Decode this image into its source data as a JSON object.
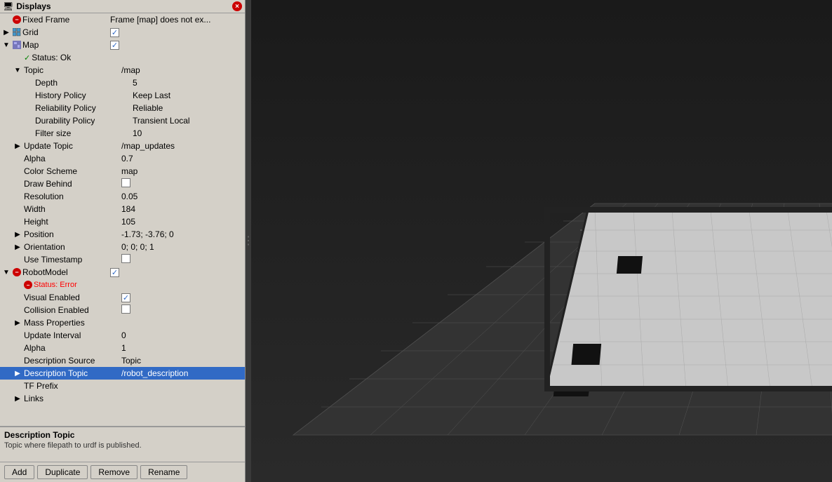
{
  "window": {
    "title": "Displays",
    "close_label": "×"
  },
  "tree": {
    "rows": [
      {
        "id": "fixed-frame",
        "indent": 0,
        "expander": null,
        "icon": "error",
        "label": "Fixed Frame",
        "value": "Frame [map] does not ex...",
        "selected": false,
        "type": "property"
      },
      {
        "id": "grid",
        "indent": 0,
        "expander": "collapsed",
        "icon": "grid",
        "label": "Grid",
        "value": "checkbox-checked",
        "selected": false,
        "type": "item"
      },
      {
        "id": "map",
        "indent": 0,
        "expander": "collapsed",
        "icon": "map",
        "label": "Map",
        "value": "checkbox-checked",
        "selected": false,
        "type": "item"
      },
      {
        "id": "map-status",
        "indent": 1,
        "expander": null,
        "icon": "ok",
        "label": "Status: Ok",
        "value": "",
        "selected": false,
        "type": "status"
      },
      {
        "id": "topic-section",
        "indent": 1,
        "expander": "expanded",
        "icon": null,
        "label": "Topic",
        "value": "/map",
        "selected": false,
        "type": "property"
      },
      {
        "id": "depth",
        "indent": 2,
        "expander": null,
        "icon": null,
        "label": "Depth",
        "value": "5",
        "selected": false,
        "type": "property"
      },
      {
        "id": "history-policy",
        "indent": 2,
        "expander": null,
        "icon": null,
        "label": "History Policy",
        "value": "Keep Last",
        "selected": false,
        "type": "property"
      },
      {
        "id": "reliability-policy",
        "indent": 2,
        "expander": null,
        "icon": null,
        "label": "Reliability Policy",
        "value": "Reliable",
        "selected": false,
        "type": "property"
      },
      {
        "id": "durability-policy",
        "indent": 2,
        "expander": null,
        "icon": null,
        "label": "Durability Policy",
        "value": "Transient Local",
        "selected": false,
        "type": "property"
      },
      {
        "id": "filter-size",
        "indent": 2,
        "expander": null,
        "icon": null,
        "label": "Filter size",
        "value": "10",
        "selected": false,
        "type": "property"
      },
      {
        "id": "update-topic",
        "indent": 1,
        "expander": "collapsed",
        "icon": null,
        "label": "Update Topic",
        "value": "/map_updates",
        "selected": false,
        "type": "property"
      },
      {
        "id": "alpha",
        "indent": 1,
        "expander": null,
        "icon": null,
        "label": "Alpha",
        "value": "0.7",
        "selected": false,
        "type": "property"
      },
      {
        "id": "color-scheme",
        "indent": 1,
        "expander": null,
        "icon": null,
        "label": "Color Scheme",
        "value": "map",
        "selected": false,
        "type": "property"
      },
      {
        "id": "draw-behind",
        "indent": 1,
        "expander": null,
        "icon": null,
        "label": "Draw Behind",
        "value": "checkbox-empty",
        "selected": false,
        "type": "property"
      },
      {
        "id": "resolution",
        "indent": 1,
        "expander": null,
        "icon": null,
        "label": "Resolution",
        "value": "0.05",
        "selected": false,
        "type": "property"
      },
      {
        "id": "width",
        "indent": 1,
        "expander": null,
        "icon": null,
        "label": "Width",
        "value": "184",
        "selected": false,
        "type": "property"
      },
      {
        "id": "height",
        "indent": 1,
        "expander": null,
        "icon": null,
        "label": "Height",
        "value": "105",
        "selected": false,
        "type": "property"
      },
      {
        "id": "position",
        "indent": 1,
        "expander": "collapsed",
        "icon": null,
        "label": "Position",
        "value": "-1.73; -3.76; 0",
        "selected": false,
        "type": "property"
      },
      {
        "id": "orientation",
        "indent": 1,
        "expander": "collapsed",
        "icon": null,
        "label": "Orientation",
        "value": "0; 0; 0; 1",
        "selected": false,
        "type": "property"
      },
      {
        "id": "use-timestamp",
        "indent": 1,
        "expander": null,
        "icon": null,
        "label": "Use Timestamp",
        "value": "checkbox-empty",
        "selected": false,
        "type": "property"
      },
      {
        "id": "robotmodel",
        "indent": 0,
        "expander": "expanded",
        "icon": "error",
        "label": "RobotModel",
        "value": "checkbox-checked-blue",
        "selected": false,
        "type": "item"
      },
      {
        "id": "robotmodel-status",
        "indent": 1,
        "expander": null,
        "icon": "error-small",
        "label": "Status: Error",
        "value": "",
        "selected": false,
        "type": "status-error"
      },
      {
        "id": "visual-enabled",
        "indent": 1,
        "expander": null,
        "icon": null,
        "label": "Visual Enabled",
        "value": "checkbox-checked",
        "selected": false,
        "type": "property"
      },
      {
        "id": "collision-enabled",
        "indent": 1,
        "expander": null,
        "icon": null,
        "label": "Collision Enabled",
        "value": "checkbox-empty",
        "selected": false,
        "type": "property"
      },
      {
        "id": "mass-properties",
        "indent": 1,
        "expander": "collapsed",
        "icon": null,
        "label": "Mass Properties",
        "value": "",
        "selected": false,
        "type": "property"
      },
      {
        "id": "update-interval",
        "indent": 1,
        "expander": null,
        "icon": null,
        "label": "Update Interval",
        "value": "0",
        "selected": false,
        "type": "property"
      },
      {
        "id": "alpha2",
        "indent": 1,
        "expander": null,
        "icon": null,
        "label": "Alpha",
        "value": "1",
        "selected": false,
        "type": "property"
      },
      {
        "id": "description-source",
        "indent": 1,
        "expander": null,
        "icon": null,
        "label": "Description Source",
        "value": "Topic",
        "selected": false,
        "type": "property"
      },
      {
        "id": "description-topic",
        "indent": 1,
        "expander": "collapsed",
        "icon": null,
        "label": "Description Topic",
        "value": "/robot_description",
        "selected": true,
        "type": "property"
      },
      {
        "id": "tf-prefix",
        "indent": 1,
        "expander": null,
        "icon": null,
        "label": "TF Prefix",
        "value": "",
        "selected": false,
        "type": "property"
      },
      {
        "id": "links",
        "indent": 1,
        "expander": "collapsed",
        "icon": null,
        "label": "Links",
        "value": "",
        "selected": false,
        "type": "property"
      }
    ]
  },
  "info": {
    "title": "Description Topic",
    "description": "Topic where filepath to urdf is published."
  },
  "buttons": {
    "add": "Add",
    "duplicate": "Duplicate",
    "remove": "Remove",
    "rename": "Rename"
  }
}
